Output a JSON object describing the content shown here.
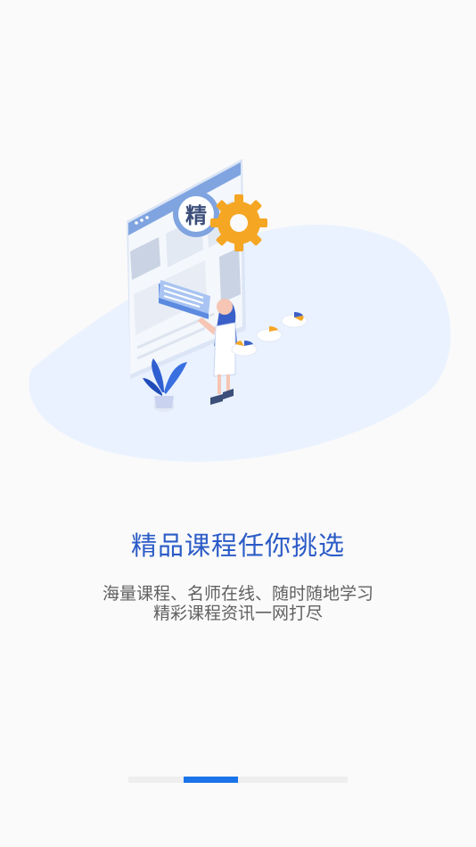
{
  "illustration": {
    "badge_char": "精"
  },
  "headline": "精品课程任你挑选",
  "description": {
    "line1": "海量课程、名师在线、随时随地学习",
    "line2": "精彩课程资讯一网打尽"
  },
  "pager": {
    "total_pages": 4,
    "current_page": 2
  },
  "colors": {
    "background": "#fafafa",
    "accent": "#1a73e8",
    "headline": "#2b5bc7",
    "body_text": "#616161",
    "gear": "#f5a623"
  }
}
